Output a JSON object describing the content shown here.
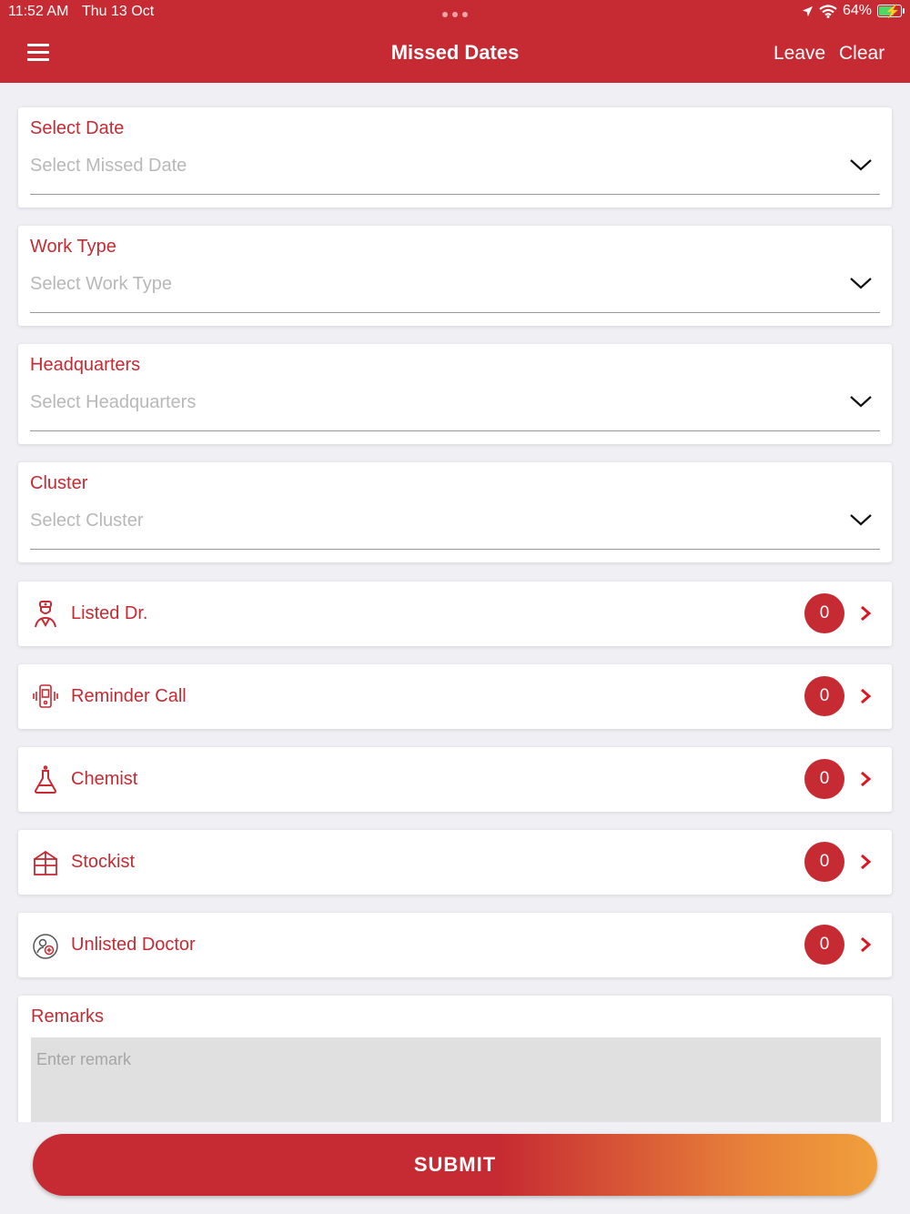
{
  "status_bar": {
    "time": "11:52 AM",
    "date": "Thu 13 Oct",
    "battery": "64%",
    "battery_level": 0.64
  },
  "header": {
    "title": "Missed Dates",
    "leave_label": "Leave",
    "clear_label": "Clear"
  },
  "fields": [
    {
      "label": "Select Date",
      "placeholder": "Select Missed Date"
    },
    {
      "label": "Work Type",
      "placeholder": "Select Work Type"
    },
    {
      "label": "Headquarters",
      "placeholder": "Select Headquarters"
    },
    {
      "label": "Cluster",
      "placeholder": "Select Cluster"
    }
  ],
  "rows": [
    {
      "label": "Listed Dr.",
      "count": "0",
      "icon": "doctor-icon"
    },
    {
      "label": "Reminder Call",
      "count": "0",
      "icon": "phone-call-icon"
    },
    {
      "label": "Chemist",
      "count": "0",
      "icon": "flask-icon"
    },
    {
      "label": "Stockist",
      "count": "0",
      "icon": "box-icon"
    },
    {
      "label": "Unlisted Doctor",
      "count": "0",
      "icon": "unlisted-doctor-icon"
    }
  ],
  "remarks": {
    "label": "Remarks",
    "placeholder": "Enter remark"
  },
  "submit_label": "SUBMIT",
  "colors": {
    "primary": "#c62a32",
    "gradient_end": "#f0a03c",
    "background": "#f0f0f4"
  }
}
